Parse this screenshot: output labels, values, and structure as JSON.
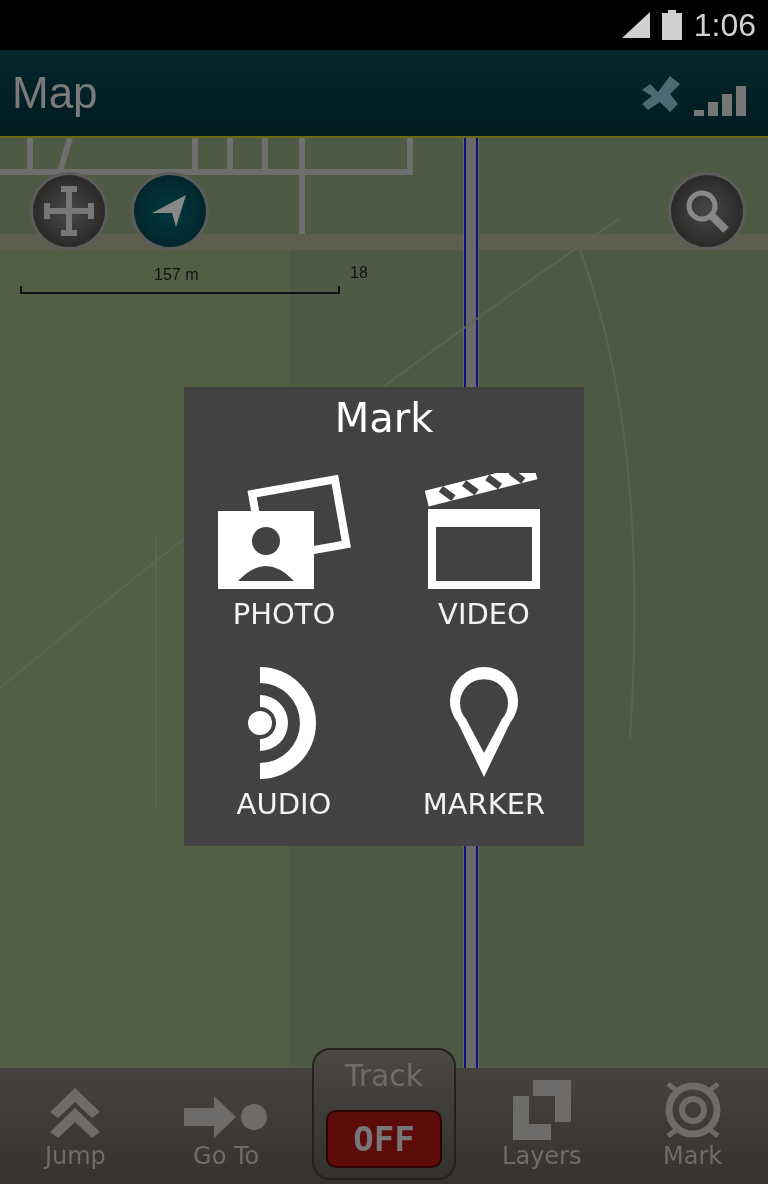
{
  "status_bar": {
    "time": "1:06"
  },
  "app_bar": {
    "title": "Map"
  },
  "map": {
    "scale": "157 m",
    "zoom": "18"
  },
  "dialog": {
    "title": "Mark",
    "options": [
      {
        "label": "PHOTO"
      },
      {
        "kind": "video",
        "label": "VIDEO"
      },
      {
        "kind": "audio",
        "label": "AUDIO"
      },
      {
        "kind": "marker",
        "label": "MARKER"
      }
    ]
  },
  "bottom_bar": {
    "items": [
      {
        "kind": "jump",
        "label": "Jump"
      },
      {
        "kind": "goto",
        "label": "Go To"
      },
      {
        "kind": "track",
        "label": "Track",
        "switch_label": "OFF",
        "on": false
      },
      {
        "kind": "layers",
        "label": "Layers"
      },
      {
        "kind": "mark",
        "label": "Mark"
      }
    ]
  }
}
